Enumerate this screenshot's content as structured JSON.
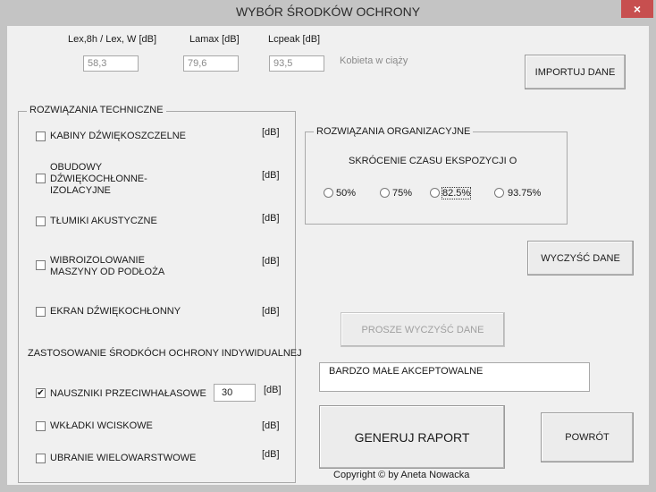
{
  "window": {
    "title": "WYBÓR ŚRODKÓW OCHRONY",
    "close_glyph": "×"
  },
  "measurements": {
    "lex_label": "Lex,8h / Lex, W [dB]",
    "lamax_label": "Lamax [dB]",
    "lcpeak_label": "Lcpeak [dB]",
    "lex_value": "58,3",
    "lamax_value": "79,6",
    "lcpeak_value": "93,5",
    "note": "Kobieta w ciąży"
  },
  "buttons": {
    "import": "IMPORTUJ DANE",
    "clear": "WYCZYŚĆ DANE",
    "please_clear": "PROSZE WYCZYŚĆ DANE",
    "report": "GENERUJ RAPORT",
    "back": "POWRÓT"
  },
  "technical": {
    "caption": "ROZWIĄZANIA TECHNICZNE",
    "unit": "[dB]",
    "items": [
      {
        "label": "KABINY DŹWIĘKOSZCZELNE",
        "checked": false
      },
      {
        "label": "OBUDOWY DŹWIĘKOCHŁONNE-IZOLACYJNE",
        "checked": false
      },
      {
        "label": "TŁUMIKI AKUSTYCZNE",
        "checked": false
      },
      {
        "label": " WIBROIZOLOWANIE MASZYNY OD PODŁOŻA",
        "checked": false
      },
      {
        "label": "EKRAN DŹWIĘKOCHŁONNY",
        "checked": false
      }
    ]
  },
  "individual": {
    "heading": "ZASTOSOWANIE ŚRODKÓCH OCHRONY INDYWIDUALNEJ",
    "unit": "[dB]",
    "items": [
      {
        "label": "NAUSZNIKI PRZECIWHAŁASOWE",
        "checked": true,
        "value": "30"
      },
      {
        "label": "WKŁADKI WCISKOWE",
        "checked": false
      },
      {
        "label": "UBRANIE WIELOWARSTWOWE",
        "checked": false
      }
    ],
    "check_glyph": "✔"
  },
  "organizational": {
    "caption": "ROZWIĄZANIA ORGANIZACYJNE",
    "subheading": "SKRÓCENIE CZASU EKSPOZYCJI O",
    "options": [
      "50%",
      "75%",
      "82.5%",
      "93.75%"
    ],
    "focused_option": "82.5%",
    "selected_option": null
  },
  "result_text": "BARDZO MAŁE AKCEPTOWALNE",
  "copyright": "Copyright © by Aneta Nowacka",
  "colors": {
    "close_button": "#c74f4f",
    "window_bg": "#f0f0f0",
    "chrome": "#c4c4c4"
  }
}
